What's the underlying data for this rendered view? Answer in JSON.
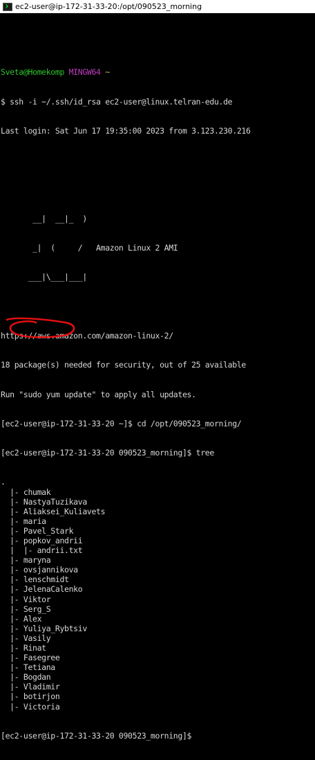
{
  "window": {
    "title": "ec2-user@ip-172-31-33-20:/opt/090523_morning"
  },
  "prompt": {
    "user_host": "Sveta@Homekomp",
    "env": "MINGW64",
    "path": "~"
  },
  "command_line": "$ ssh -i ~/.ssh/id_rsa ec2-user@linux.telran-edu.de",
  "last_login": "Last login: Sat Jun 17 19:35:00 2023 from 3.123.230.216",
  "banner": {
    "art_line_1": "       __|  __|_  )",
    "art_line_2": "       _|  (     /   Amazon Linux 2 AMI",
    "art_line_3": "      ___|\\___|___|"
  },
  "info": {
    "url": "https://aws.amazon.com/amazon-linux-2/",
    "packages": "18 package(s) needed for security, out of 25 available",
    "update_hint": "Run \"sudo yum update\" to apply all updates."
  },
  "commands": {
    "cd_line": "[ec2-user@ip-172-31-33-20 ~]$ cd /opt/090523_morning/",
    "tree_line": "[ec2-user@ip-172-31-33-20 090523_morning]$ tree",
    "final_prompt": "[ec2-user@ip-172-31-33-20 090523_morning]$"
  },
  "tree": [
    ".",
    "  |- chumak",
    "  |- NastyaTuzikava",
    "  |- Aliaksei_Kuliavets",
    "  |- maria",
    "  |- Pavel_Stark",
    "  |- popkov_andrii",
    "  |  |- andrii.txt",
    "  |- maryna",
    "  |- ovsjannikova",
    "  |- lenschmidt",
    "  |- JelenaCalenko",
    "  |- Viktor",
    "  |- Serg_S",
    "  |- Alex",
    "  |- Yuliya_Rybtsiv",
    "  |- Vasily",
    "  |- Rinat",
    "  |- Fasegree",
    "  |- Tetiana",
    "  |- Bogdan",
    "  |- Vladimir",
    "  |- botirjon",
    "  |- Victoria"
  ],
  "colors": {
    "terminal_bg": "#000000",
    "text": "#d8d8d8",
    "prompt_green": "#2dc52d",
    "prompt_purple": "#c03cc0",
    "path_yellow": "#bfbf40",
    "annotation_red": "#e01010"
  },
  "icons": {
    "app": "terminal-app-icon"
  }
}
